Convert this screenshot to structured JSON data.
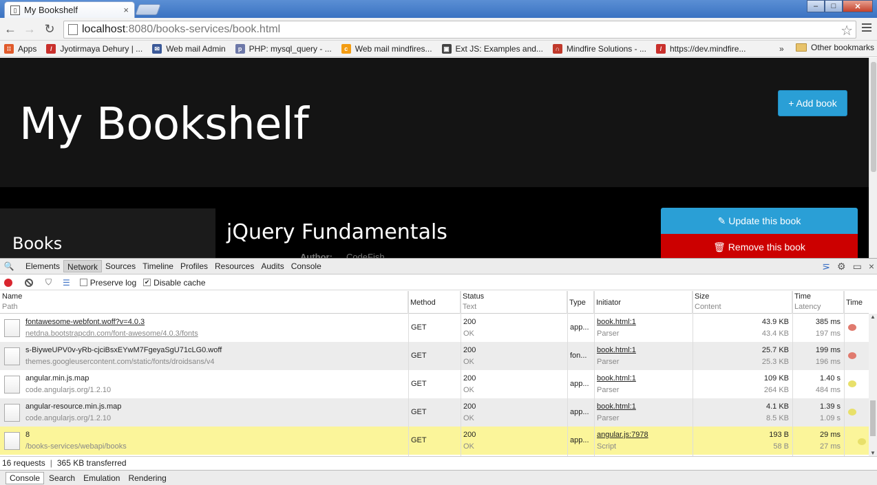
{
  "browser": {
    "tab_title": "My Bookshelf",
    "tab_close": "×",
    "window_controls": {
      "minimize": "–",
      "maximize": "□",
      "close": "✕"
    },
    "url_host": "localhost",
    "url_path": ":8080/books-services/book.html"
  },
  "bookmarks": {
    "items": [
      {
        "label": "Apps",
        "icon_color": "#e05a2b",
        "icon": "apps-grid-icon"
      },
      {
        "label": "Jyotirmaya Dehury | ...",
        "icon_color": "#c9302c",
        "icon": "bookmark-icon"
      },
      {
        "label": "Web mail Admin",
        "icon_color": "#3b5998",
        "icon": "mail-icon"
      },
      {
        "label": "PHP: mysql_query - ...",
        "icon_color": "#6d78a8",
        "icon": "php-icon"
      },
      {
        "label": "Web mail mindfires...",
        "icon_color": "#f39c12",
        "icon": "cpanel-icon"
      },
      {
        "label": "Ext JS: Examples and...",
        "icon_color": "#444444",
        "icon": "extjs-icon"
      },
      {
        "label": "Mindfire Solutions - ...",
        "icon_color": "#c0392b",
        "icon": "mindfire-icon"
      },
      {
        "label": "https://dev.mindfire...",
        "icon_color": "#c9302c",
        "icon": "bookmark-icon"
      }
    ],
    "more": "»",
    "other": "Other bookmarks"
  },
  "page": {
    "heading": "My Bookshelf",
    "add_book": "+ Add book",
    "sidebar_title": "Books",
    "book_title": "jQuery Fundamentals",
    "author_label": "Author:",
    "author_value": "CodeFish",
    "update_button": "✎ Update this book",
    "remove_button": "🗑 Remove this book"
  },
  "devtools": {
    "tabs": [
      "Elements",
      "Network",
      "Sources",
      "Timeline",
      "Profiles",
      "Resources",
      "Audits",
      "Console"
    ],
    "active_tab": "Network",
    "preserve_log": "Preserve log",
    "disable_cache": "Disable cache",
    "columns": {
      "name": "Name",
      "path": "Path",
      "method": "Method",
      "status": "Status",
      "text": "Text",
      "type": "Type",
      "initiator": "Initiator",
      "size": "Size",
      "content": "Content",
      "time": "Time",
      "latency": "Latency",
      "timeline": "Time"
    },
    "rows": [
      {
        "name": "fontawesome-webfont.woff?v=4.0.3",
        "path": "netdna.bootstrapcdn.com/font-awesome/4.0.3/fonts",
        "method": "GET",
        "status": "200",
        "status_text": "OK",
        "type": "app...",
        "initiator": "book.html:1",
        "initiator_type": "Parser",
        "size": "43.9 KB",
        "content": "43.4 KB",
        "time": "385 ms",
        "latency": "197 ms",
        "bar_color": "#e07a6e"
      },
      {
        "name": "s-BiyweUPV0v-yRb-cjciBsxEYwM7FgeyaSgU71cLG0.woff",
        "path": "themes.googleusercontent.com/static/fonts/droidsans/v4",
        "method": "GET",
        "status": "200",
        "status_text": "OK",
        "type": "fon...",
        "initiator": "book.html:1",
        "initiator_type": "Parser",
        "size": "25.7 KB",
        "content": "25.3 KB",
        "time": "199 ms",
        "latency": "196 ms",
        "bar_color": "#e07a6e"
      },
      {
        "name": "angular.min.js.map",
        "path": "code.angularjs.org/1.2.10",
        "method": "GET",
        "status": "200",
        "status_text": "OK",
        "type": "app...",
        "initiator": "book.html:1",
        "initiator_type": "Parser",
        "size": "109 KB",
        "content": "264 KB",
        "time": "1.40 s",
        "latency": "484 ms",
        "bar_color": "#e8e06a"
      },
      {
        "name": "angular-resource.min.js.map",
        "path": "code.angularjs.org/1.2.10",
        "method": "GET",
        "status": "200",
        "status_text": "OK",
        "type": "app...",
        "initiator": "book.html:1",
        "initiator_type": "Parser",
        "size": "4.1 KB",
        "content": "8.5 KB",
        "time": "1.39 s",
        "latency": "1.09 s",
        "bar_color": "#e8e06a"
      },
      {
        "name": "8",
        "path": "/books-services/webapi/books",
        "method": "GET",
        "status": "200",
        "status_text": "OK",
        "type": "app...",
        "initiator": "angular.js:7978",
        "initiator_type": "Script",
        "size": "193 B",
        "content": "58 B",
        "time": "29 ms",
        "latency": "27 ms",
        "bar_color": "#e8e06a"
      }
    ],
    "summary_requests": "16 requests",
    "summary_sep": "|",
    "summary_transferred": "365 KB transferred",
    "drawer_tabs": [
      "Console",
      "Search",
      "Emulation",
      "Rendering"
    ]
  }
}
